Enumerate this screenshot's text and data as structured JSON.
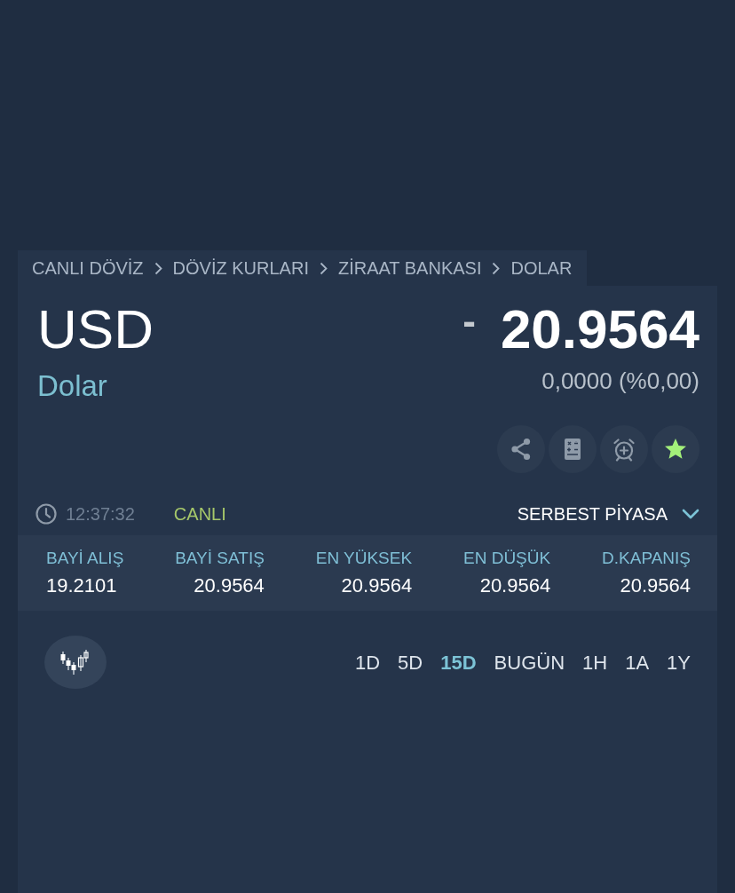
{
  "breadcrumb": [
    "CANLI DÖVİZ",
    "DÖVİZ KURLARI",
    "ZİRAAT BANKASI",
    "DOLAR"
  ],
  "quote": {
    "symbol": "USD",
    "name": "Dolar",
    "sign": "-",
    "price": "20.9564",
    "change": "0,0000 (%0,00)"
  },
  "actions": [
    {
      "kind": "share",
      "on": false
    },
    {
      "kind": "calculator",
      "on": false
    },
    {
      "kind": "alarm",
      "on": false
    },
    {
      "kind": "favorite",
      "on": true
    }
  ],
  "status": {
    "time": "12:37:32",
    "live": "CANLI",
    "market": "SERBEST PİYASA"
  },
  "stats": [
    {
      "label": "BAYİ ALIŞ",
      "value": "19.2101"
    },
    {
      "label": "BAYİ SATIŞ",
      "value": "20.9564"
    },
    {
      "label": "EN YÜKSEK",
      "value": "20.9564"
    },
    {
      "label": "EN DÜŞÜK",
      "value": "20.9564"
    },
    {
      "label": "D.KAPANIŞ",
      "value": "20.9564"
    }
  ],
  "periods": [
    {
      "label": "1D",
      "selected": false
    },
    {
      "label": "5D",
      "selected": false
    },
    {
      "label": "15D",
      "selected": true
    },
    {
      "label": "BUGÜN",
      "selected": false
    },
    {
      "label": "1H",
      "selected": false
    },
    {
      "label": "1A",
      "selected": false
    },
    {
      "label": "1Y",
      "selected": false
    }
  ]
}
